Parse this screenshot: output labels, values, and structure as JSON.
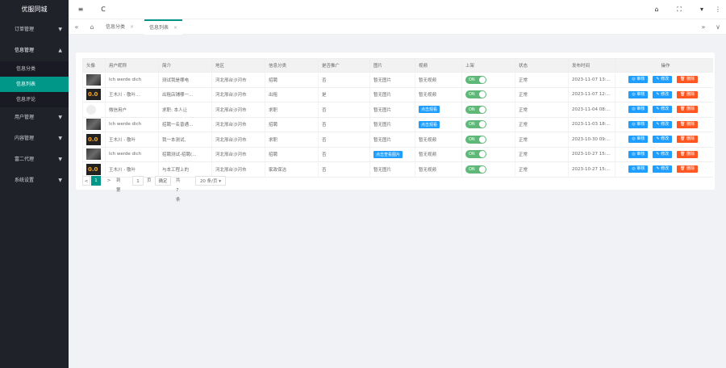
{
  "app": {
    "title": "优服同城"
  },
  "sidebar": {
    "groups": [
      {
        "label": "订单管理",
        "arrow": "▼"
      },
      {
        "label": "信息管理",
        "arrow": "▲",
        "items": [
          "信息分类",
          "信息列表",
          "信息评论"
        ]
      },
      {
        "label": "用户管理",
        "arrow": "▼"
      },
      {
        "label": "内容管理",
        "arrow": "▼"
      },
      {
        "label": "富二代理",
        "arrow": "▼"
      },
      {
        "label": "系统设置",
        "arrow": "▼"
      }
    ]
  },
  "header": {
    "menu_icon": "≡",
    "refresh_icon": "C",
    "right_icons": [
      "⌂",
      "⛶",
      "▾",
      "⋮"
    ]
  },
  "tabs": {
    "prev": "«",
    "home": "⌂",
    "items": [
      {
        "label": "信息分类",
        "close": "×"
      },
      {
        "label": "信息列表",
        "close": "×"
      }
    ],
    "next": "»",
    "more": "∨"
  },
  "table": {
    "headers": [
      "头像",
      "用户昵称",
      "简介",
      "地区",
      "信息分类",
      "是否推广",
      "图片",
      "视频",
      "上架",
      "状态",
      "发布时间",
      "操作"
    ],
    "rows": [
      {
        "avatar": "dark",
        "nick": "Ich werde dich",
        "intro": "测试我是哪电",
        "region": "河北邢台沙河市",
        "cat": "招聘",
        "promote": "否",
        "image": "暂无图片",
        "image_tag": false,
        "video": "暂无视频",
        "video_tag": false,
        "shelf": "ON",
        "status": "正常",
        "time": "2023-11-07 13:..."
      },
      {
        "avatar": "brown",
        "nick": "王木川 - 敬叶...",
        "intro": "出租店铺哪一...",
        "region": "河北邢台沙河市",
        "cat": "出租",
        "promote": "是",
        "image": "暂无图片",
        "image_tag": false,
        "video": "暂无视频",
        "video_tag": false,
        "shelf": "ON",
        "status": "正常",
        "time": "2023-11-07 12:..."
      },
      {
        "avatar": "blank",
        "nick": "微信用户",
        "intro": "求职: 本人让",
        "region": "河北邢台沙河市",
        "cat": "求职",
        "promote": "否",
        "image": "暂无图片",
        "image_tag": false,
        "video": "点击观看",
        "video_tag": true,
        "shelf": "ON",
        "status": "正常",
        "time": "2023-11-04 08:..."
      },
      {
        "avatar": "dark",
        "nick": "Ich werde dich",
        "intro": "招聘一名普通...",
        "region": "河北邢台沙河市",
        "cat": "招聘",
        "promote": "否",
        "image": "暂无图片",
        "image_tag": false,
        "video": "点击观看",
        "video_tag": true,
        "shelf": "ON",
        "status": "正常",
        "time": "2023-11-03 18:..."
      },
      {
        "avatar": "brown",
        "nick": "王木川 - 敬叶",
        "intro": "我一本测试,",
        "region": "河北邢台沙河市",
        "cat": "求职",
        "promote": "否",
        "image": "暂无图片",
        "image_tag": false,
        "video": "暂无视频",
        "video_tag": false,
        "shelf": "ON",
        "status": "正常",
        "time": "2023-10-30 09:..."
      },
      {
        "avatar": "dark",
        "nick": "Ich werde dich",
        "intro": "招聘测试-招聘(...",
        "region": "河北邢台沙河市",
        "cat": "招聘",
        "promote": "否",
        "image": "点击查看图片",
        "image_tag": true,
        "video": "暂无视频",
        "video_tag": false,
        "shelf": "ON",
        "status": "正常",
        "time": "2023-10-27 15:..."
      },
      {
        "avatar": "brown",
        "nick": "王木川 - 敬叶",
        "intro": "与本工程上的",
        "region": "河北邢台沙河市",
        "cat": "家政保洁",
        "promote": "否",
        "image": "暂无图片",
        "image_tag": false,
        "video": "暂无视频",
        "video_tag": false,
        "shelf": "ON",
        "status": "正常",
        "time": "2023-10-27 15:..."
      }
    ],
    "actions": {
      "review": "审核",
      "edit": "修改",
      "delete": "删除"
    }
  },
  "pager": {
    "prev": "<",
    "current": "1",
    "next": ">",
    "goto_label": "到第",
    "goto_value": "1",
    "page_unit": "页",
    "confirm": "确定",
    "total": "共 7 条",
    "per_page": "20 条/页 ▾"
  }
}
